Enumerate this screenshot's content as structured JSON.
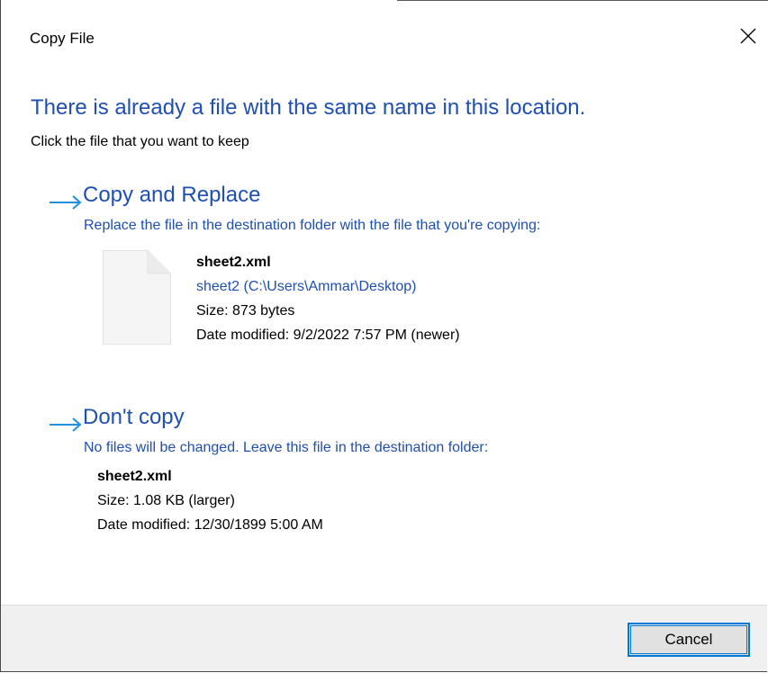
{
  "window": {
    "title": "Copy File",
    "close_icon": "close-icon"
  },
  "main": {
    "heading": "There is already a file with the same name in this location.",
    "subheading": "Click the file that you want to keep"
  },
  "options": {
    "replace": {
      "icon": "arrow-right-icon",
      "title": "Copy and Replace",
      "description": "Replace the file in the destination folder with the file that you're copying:",
      "file_icon": "document-icon",
      "file_name": "sheet2.xml",
      "file_path": "sheet2 (C:\\Users\\Ammar\\Desktop)",
      "size": "Size: 873 bytes",
      "date_modified": "Date modified: 9/2/2022 7:57 PM (newer)"
    },
    "dont_copy": {
      "icon": "arrow-right-icon",
      "title": "Don't copy",
      "description": "No files will be changed. Leave this file in the destination folder:",
      "file_name": "sheet2.xml",
      "size": "Size: 1.08 KB (larger)",
      "date_modified": "Date modified: 12/30/1899 5:00 AM"
    }
  },
  "footer": {
    "cancel_label": "Cancel"
  },
  "colors": {
    "accent_blue": "#1f4fb0",
    "arrow_blue": "#1e90e0",
    "focus_border": "#0078d7",
    "footer_bg": "#f0f0f0"
  }
}
